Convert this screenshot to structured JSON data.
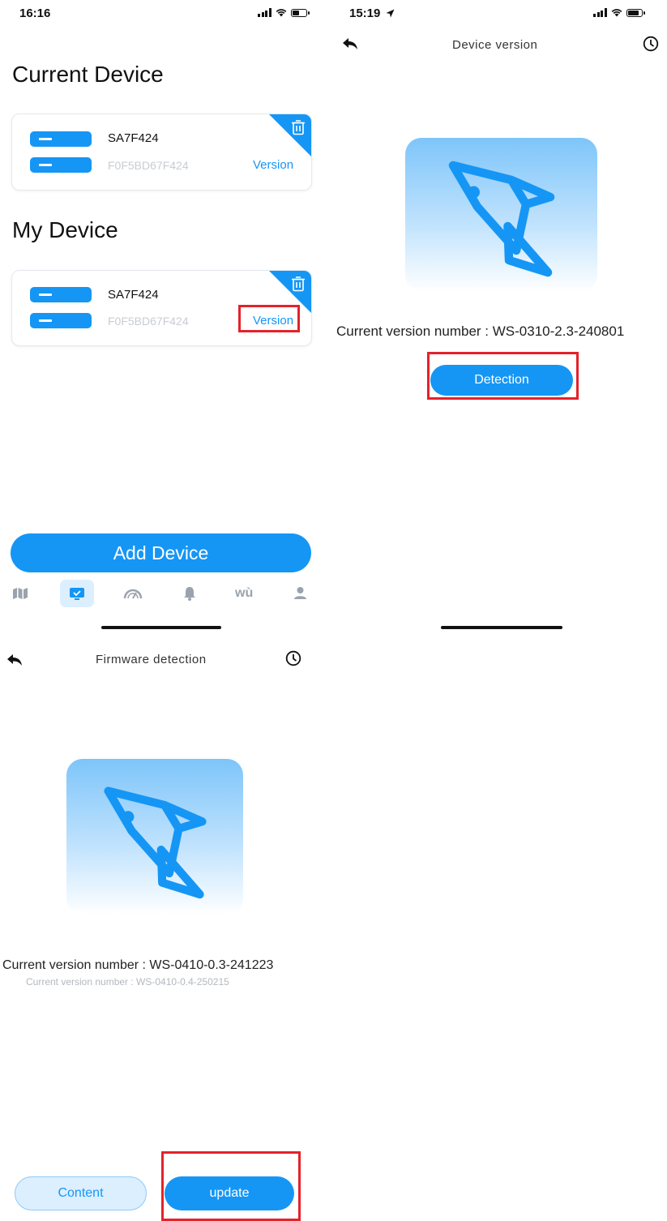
{
  "screen1": {
    "status": {
      "time": "16:16"
    },
    "current_section_title": "Current Device",
    "my_section_title": "My Device",
    "current_device": {
      "name": "SA7F424",
      "mac": "F0F5BD67F424",
      "version_label": "Version"
    },
    "my_device": {
      "name": "SA7F424",
      "mac": "F0F5BD67F424",
      "version_label": "Version"
    },
    "add_button_label": "Add Device",
    "tabbar": [
      {
        "icon": "map-icon"
      },
      {
        "icon": "device-icon",
        "active": true
      },
      {
        "icon": "gauge-icon"
      },
      {
        "icon": "bell-icon"
      },
      {
        "icon": "wu-icon",
        "label": "wù"
      },
      {
        "icon": "user-icon"
      }
    ]
  },
  "screen2": {
    "status": {
      "time": "15:19"
    },
    "title": "Device version",
    "current_version_text": "Current version number : WS-0310-2.3-240801",
    "detect_button_label": "Detection"
  },
  "screen3": {
    "title": "Firmware detection",
    "current_version_text": "Current version number : WS-0410-0.3-241223",
    "new_version_text": "Current version number : WS-0410-0.4-250215",
    "content_button_label": "Content",
    "update_button_label": "update"
  },
  "colors": {
    "accent": "#1596f5",
    "highlight": "#e4222a",
    "muted_text": "#c8ccd2"
  }
}
